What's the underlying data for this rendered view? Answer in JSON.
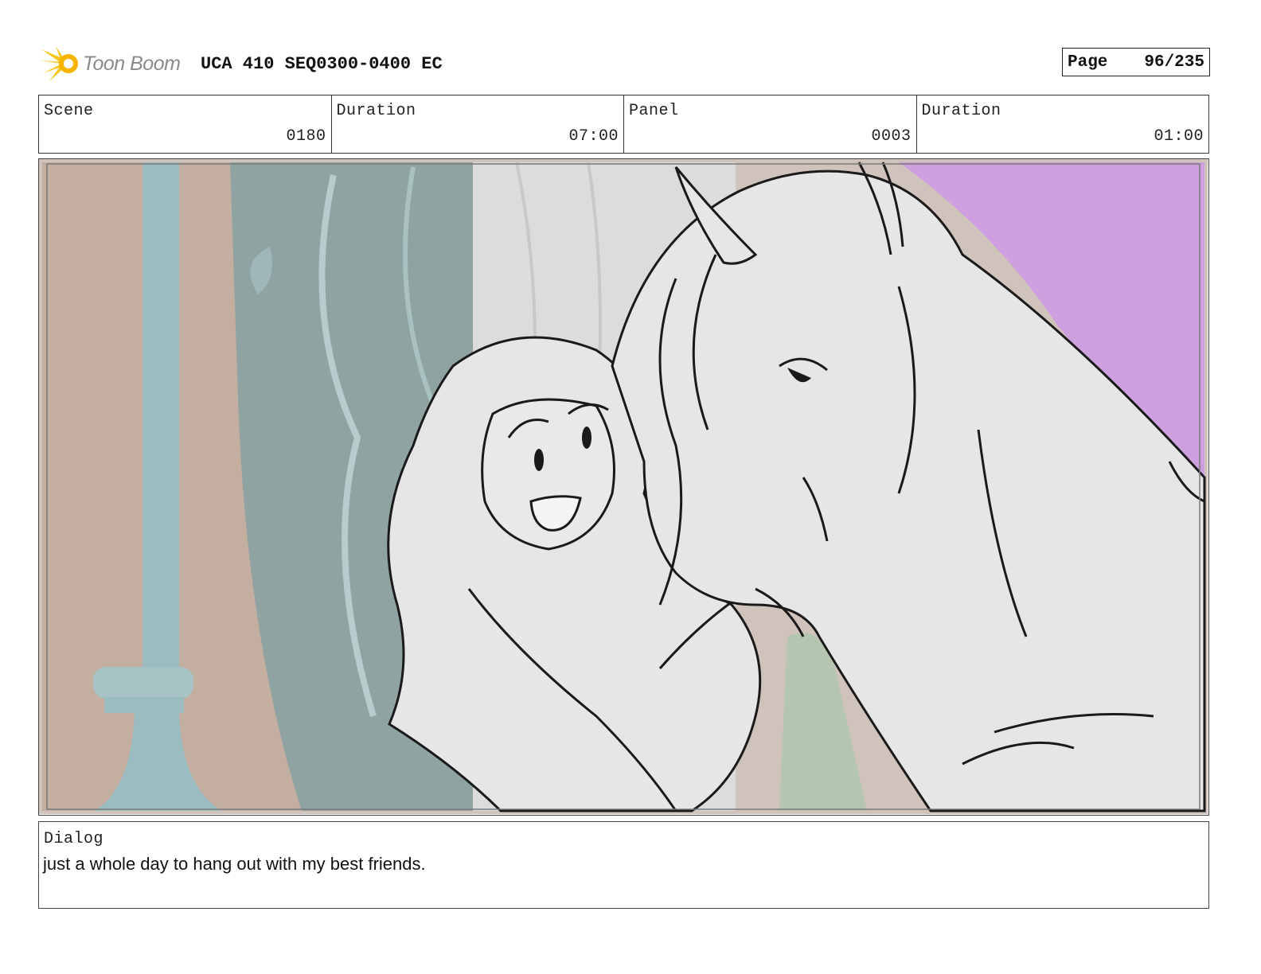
{
  "header": {
    "logo_text": "Toon Boom",
    "project_title": "UCA 410 SEQ0300-0400 EC",
    "page_label": "Page",
    "page_value": "96/235"
  },
  "info": {
    "scene_label": "Scene",
    "scene_value": "0180",
    "scene_duration_label": "Duration",
    "scene_duration_value": "07:00",
    "panel_label": "Panel",
    "panel_value": "0003",
    "panel_duration_label": "Duration",
    "panel_duration_value": "01:00"
  },
  "dialog": {
    "label": "Dialog",
    "text": "just a whole day to hang out with my best friends."
  },
  "colors": {
    "logo_accent": "#f5c518",
    "sky_purple": "#cfa0e0",
    "wall_tan": "#c4aea0",
    "window_teal": "#8fa3a2",
    "pillar_teal": "#9bbcc0",
    "sketch_gray": "#e6e6e6",
    "line": "#1a1a1a"
  }
}
